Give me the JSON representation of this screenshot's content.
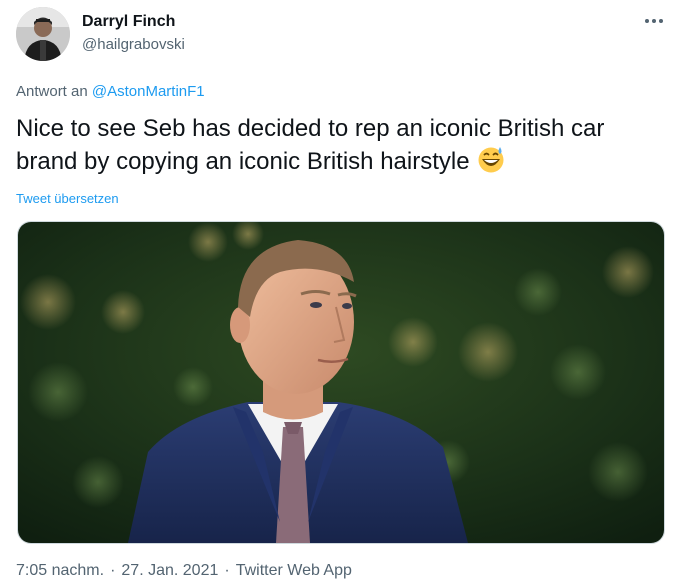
{
  "author": {
    "name": "Darryl Finch",
    "handle": "@hailgrabovski"
  },
  "reply": {
    "prefix": "Antwort an",
    "mention": "@AstonMartinF1"
  },
  "tweet": {
    "text": "Nice to see Seb has decided to rep an iconic British car brand by copying an iconic British hairstyle",
    "emoji": "grinning-face-with-sweat",
    "translate_label": "Tweet übersetzen"
  },
  "media": {
    "type": "photo",
    "subject": "man-in-suit-against-green-bokeh"
  },
  "meta": {
    "time": "7:05 nachm.",
    "date": "27. Jan. 2021",
    "source": "Twitter Web App"
  },
  "icons": {
    "more": "more-horizontal-icon"
  },
  "colors": {
    "link": "#1d9bf0",
    "secondary_text": "#536471",
    "primary_text": "#0f1419"
  }
}
